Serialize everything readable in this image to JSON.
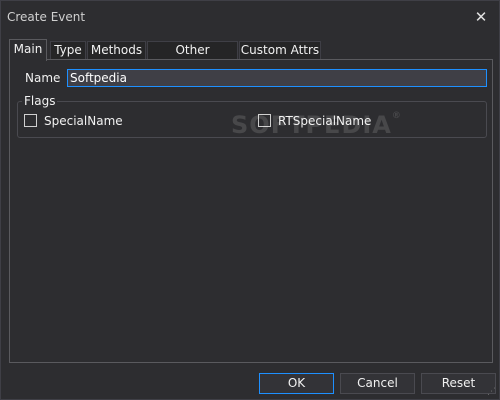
{
  "window": {
    "title": "Create Event",
    "close_glyph": "✕"
  },
  "tabs": [
    {
      "label": "Main",
      "active": true
    },
    {
      "label": "Type"
    },
    {
      "label": "Methods"
    },
    {
      "label": "Other Methods"
    },
    {
      "label": "Custom Attrs"
    }
  ],
  "main": {
    "name_label": "Name",
    "name_value": "Softpedia",
    "flags": {
      "legend": "Flags",
      "items": [
        {
          "label": "SpecialName",
          "checked": false
        },
        {
          "label": "RTSpecialName",
          "checked": false
        }
      ]
    }
  },
  "watermark": {
    "text": "SOFTPEDIA",
    "mark": "®"
  },
  "buttons": {
    "ok": "OK",
    "cancel": "Cancel",
    "reset": "Reset"
  },
  "colors": {
    "background": "#2d2d30",
    "border": "#3f3f46",
    "focus_accent": "#1e90ff",
    "text": "#f1f1f1"
  }
}
